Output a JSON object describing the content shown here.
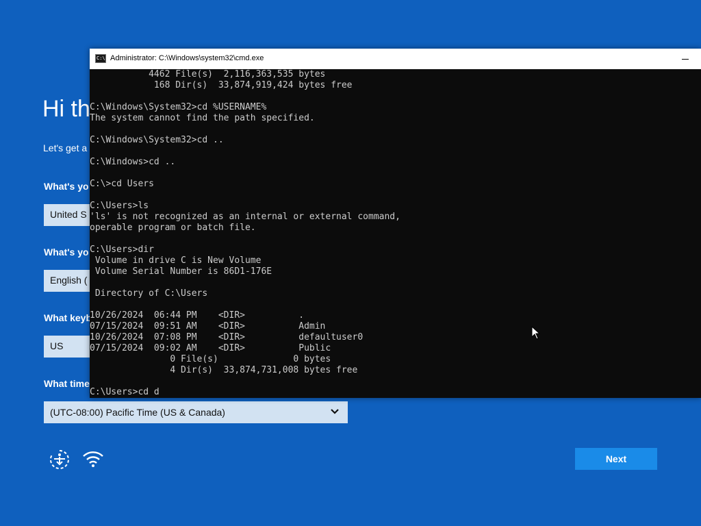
{
  "oobe": {
    "greeting": "Hi th",
    "subtitle": "Let's get a",
    "q_region": "What's yo",
    "region_value": "United S",
    "q_language": "What's yo",
    "language_value": "English (",
    "q_keyboard": "What keyb",
    "keyboard_value": "US",
    "q_timezone": "What time",
    "timezone_value": "(UTC-08:00) Pacific Time (US & Canada)",
    "next_label": "Next",
    "icons": [
      "accessibility-icon",
      "wifi-icon",
      "chevron-down-icon"
    ]
  },
  "cmd": {
    "title": "Administrator: C:\\Windows\\system32\\cmd.exe",
    "lines": [
      "           4462 File(s)  2,116,363,535 bytes",
      "            168 Dir(s)  33,874,919,424 bytes free",
      "",
      "C:\\Windows\\System32>cd %USERNAME%",
      "The system cannot find the path specified.",
      "",
      "C:\\Windows\\System32>cd ..",
      "",
      "C:\\Windows>cd ..",
      "",
      "C:\\>cd Users",
      "",
      "C:\\Users>ls",
      "'ls' is not recognized as an internal or external command,",
      "operable program or batch file.",
      "",
      "C:\\Users>dir",
      " Volume in drive C is New Volume",
      " Volume Serial Number is 86D1-176E",
      "",
      " Directory of C:\\Users",
      "",
      "10/26/2024  06:44 PM    <DIR>          .",
      "07/15/2024  09:51 AM    <DIR>          Admin",
      "10/26/2024  07:08 PM    <DIR>          defaultuser0",
      "07/15/2024  09:02 AM    <DIR>          Public",
      "               0 File(s)              0 bytes",
      "               4 Dir(s)  33,874,731,008 bytes free",
      "",
      "C:\\Users>cd d"
    ]
  }
}
